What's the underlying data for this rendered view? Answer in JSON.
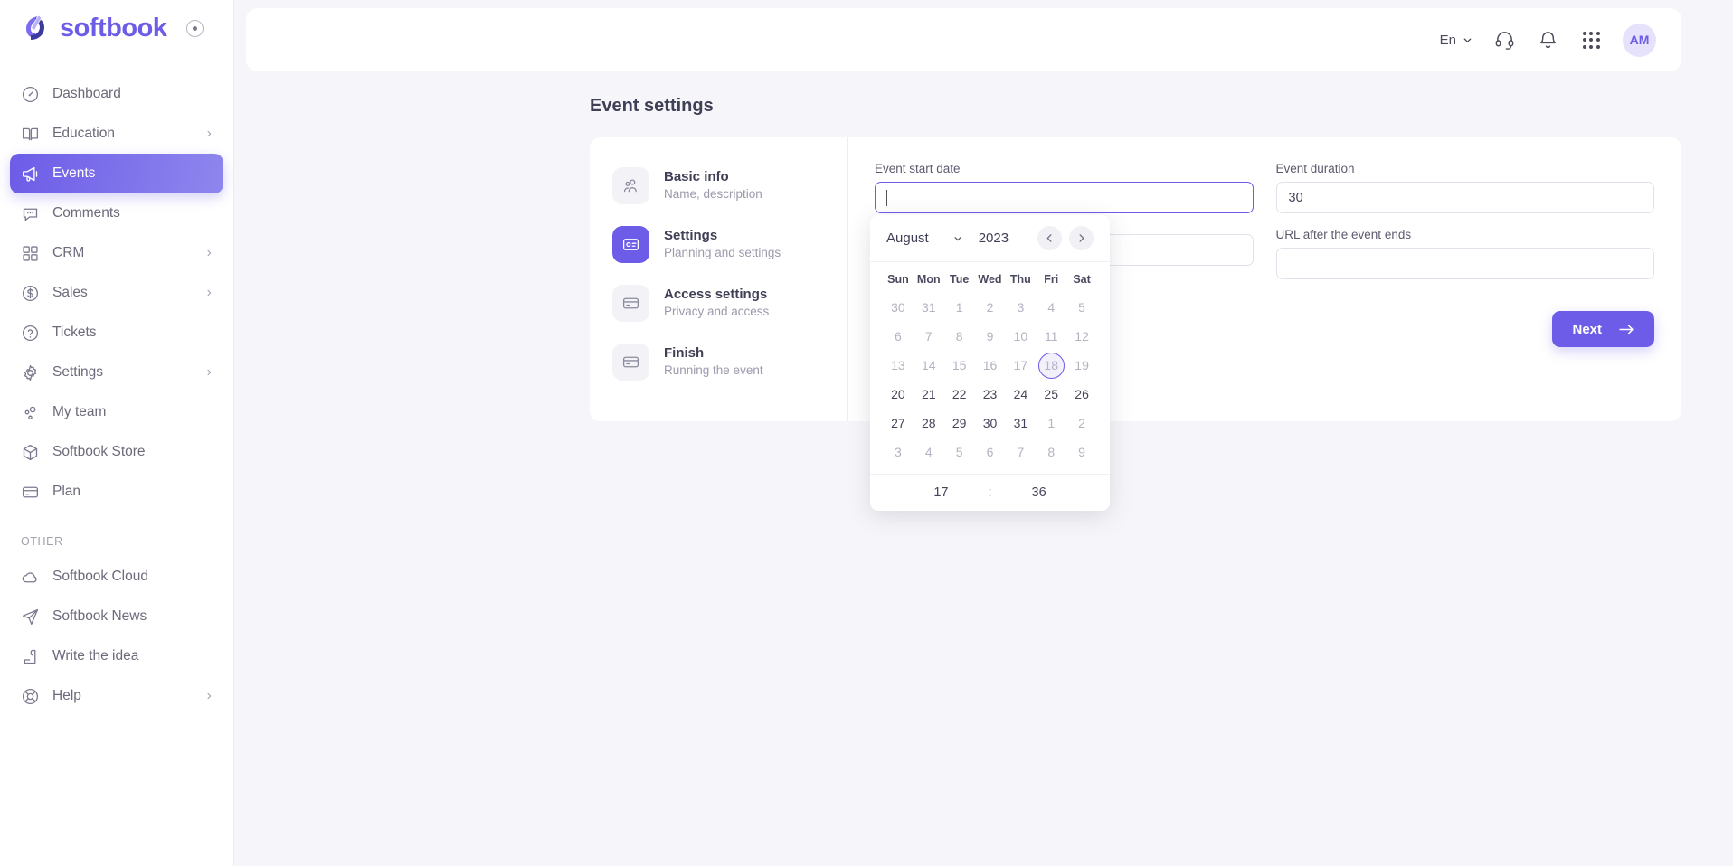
{
  "brand": {
    "name": "softbook",
    "accent": "#6c5ce7",
    "toggle_icon": "circle-dot-icon"
  },
  "sidebar": {
    "items": [
      {
        "label": "Dashboard",
        "icon": "speedometer-icon",
        "chevron": false,
        "active": false
      },
      {
        "label": "Education",
        "icon": "book-icon",
        "chevron": true,
        "active": false
      },
      {
        "label": "Events",
        "icon": "megaphone-icon",
        "chevron": false,
        "active": true
      },
      {
        "label": "Comments",
        "icon": "chat-bubble-icon",
        "chevron": false,
        "active": false
      },
      {
        "label": "CRM",
        "icon": "grid-squares-icon",
        "chevron": true,
        "active": false
      },
      {
        "label": "Sales",
        "icon": "dollar-circle-icon",
        "chevron": true,
        "active": false
      },
      {
        "label": "Tickets",
        "icon": "question-circle-icon",
        "chevron": false,
        "active": false
      },
      {
        "label": "Settings",
        "icon": "gear-icon",
        "chevron": true,
        "active": false
      },
      {
        "label": "My team",
        "icon": "people-icon",
        "chevron": false,
        "active": false
      },
      {
        "label": "Softbook Store",
        "icon": "box-icon",
        "chevron": false,
        "active": false
      },
      {
        "label": "Plan",
        "icon": "card-icon",
        "chevron": false,
        "active": false
      }
    ],
    "other_section_label": "OTHER",
    "other_items": [
      {
        "label": "Softbook Cloud",
        "icon": "cloud-icon",
        "chevron": false
      },
      {
        "label": "Softbook News",
        "icon": "paper-plane-icon",
        "chevron": false
      },
      {
        "label": "Write the idea",
        "icon": "pen-note-icon",
        "chevron": false
      },
      {
        "label": "Help",
        "icon": "lifebuoy-icon",
        "chevron": true
      }
    ]
  },
  "topbar": {
    "language": "En",
    "language_chevron_icon": "chevron-down-icon",
    "support_icon": "headset-icon",
    "notifications_icon": "bell-icon",
    "apps_icon": "apps-grid-icon",
    "avatar_initials": "AM"
  },
  "page": {
    "title": "Event settings"
  },
  "steps": [
    {
      "title": "Basic info",
      "subtitle": "Name, description",
      "icon": "users-icon",
      "active": false
    },
    {
      "title": "Settings",
      "subtitle": "Planning and settings",
      "icon": "id-card-icon",
      "active": true
    },
    {
      "title": "Access settings",
      "subtitle": "Privacy and access",
      "icon": "credit-card-icon",
      "active": false
    },
    {
      "title": "Finish",
      "subtitle": "Running the event",
      "icon": "credit-card-icon",
      "active": false
    }
  ],
  "form": {
    "start_date": {
      "label": "Event start date",
      "value": "",
      "placeholder": ""
    },
    "duration": {
      "label": "Event duration",
      "value": "30",
      "placeholder": ""
    },
    "field_left_2": {
      "label": "",
      "value": "",
      "placeholder": ""
    },
    "url_after": {
      "label": "URL after the event ends",
      "value": "",
      "placeholder": ""
    },
    "next_button": {
      "label": "Next",
      "icon": "arrow-right-icon"
    }
  },
  "datepicker": {
    "month": "August",
    "year": "2023",
    "month_chevron_icon": "chevron-down-icon",
    "prev_icon": "chevron-left-icon",
    "next_icon": "chevron-right-icon",
    "weekdays": [
      "Sun",
      "Mon",
      "Tue",
      "Wed",
      "Thu",
      "Fri",
      "Sat"
    ],
    "weeks": [
      [
        {
          "d": "30",
          "m": true
        },
        {
          "d": "31",
          "m": true
        },
        {
          "d": "1",
          "m": true
        },
        {
          "d": "2",
          "m": true
        },
        {
          "d": "3",
          "m": true
        },
        {
          "d": "4",
          "m": true
        },
        {
          "d": "5",
          "m": true
        }
      ],
      [
        {
          "d": "6",
          "m": true
        },
        {
          "d": "7",
          "m": true
        },
        {
          "d": "8",
          "m": true
        },
        {
          "d": "9",
          "m": true
        },
        {
          "d": "10",
          "m": true
        },
        {
          "d": "11",
          "m": true
        },
        {
          "d": "12",
          "m": true
        }
      ],
      [
        {
          "d": "13",
          "m": true
        },
        {
          "d": "14",
          "m": true
        },
        {
          "d": "15",
          "m": true
        },
        {
          "d": "16",
          "m": true
        },
        {
          "d": "17",
          "m": true
        },
        {
          "d": "18",
          "m": true,
          "today": true
        },
        {
          "d": "19",
          "m": true
        }
      ],
      [
        {
          "d": "20",
          "m": false
        },
        {
          "d": "21",
          "m": false
        },
        {
          "d": "22",
          "m": false
        },
        {
          "d": "23",
          "m": false
        },
        {
          "d": "24",
          "m": false
        },
        {
          "d": "25",
          "m": false
        },
        {
          "d": "26",
          "m": false
        }
      ],
      [
        {
          "d": "27",
          "m": false
        },
        {
          "d": "28",
          "m": false
        },
        {
          "d": "29",
          "m": false
        },
        {
          "d": "30",
          "m": false
        },
        {
          "d": "31",
          "m": false
        },
        {
          "d": "1",
          "m": true
        },
        {
          "d": "2",
          "m": true
        }
      ],
      [
        {
          "d": "3",
          "m": true
        },
        {
          "d": "4",
          "m": true
        },
        {
          "d": "5",
          "m": true
        },
        {
          "d": "6",
          "m": true
        },
        {
          "d": "7",
          "m": true
        },
        {
          "d": "8",
          "m": true
        },
        {
          "d": "9",
          "m": true
        }
      ]
    ],
    "time": {
      "hour": "17",
      "separator": ":",
      "minute": "36"
    }
  }
}
